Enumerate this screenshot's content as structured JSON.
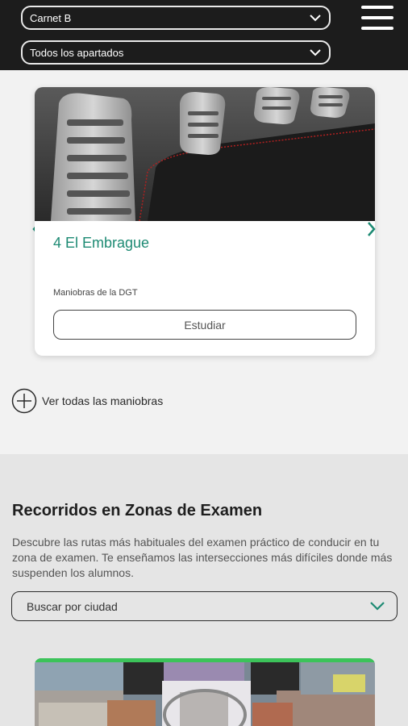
{
  "header": {
    "license_select": "Carnet B",
    "section_select": "Todos los apartados"
  },
  "maneuver_card": {
    "title": "4 El Embrague",
    "subtitle": "Maniobras de la DGT",
    "study_button": "Estudiar"
  },
  "view_all_link": "Ver todas las maniobras",
  "exam_routes": {
    "title": "Recorridos en Zonas de Examen",
    "description": "Descubre las rutas más habituales del examen práctico de conducir en tu zona de examen. Te enseñamos las intersecciones más difíciles donde más suspenden los alumnos.",
    "city_select_placeholder": "Buscar por ciudad"
  },
  "colors": {
    "accent": "#1d8a73",
    "header_bg": "#1c1c1c",
    "green_bar": "#3cc35a"
  },
  "icons": [
    "chevron-down-icon",
    "hamburger-menu-icon",
    "chevron-left-icon",
    "chevron-right-icon",
    "plus-circle-icon"
  ]
}
